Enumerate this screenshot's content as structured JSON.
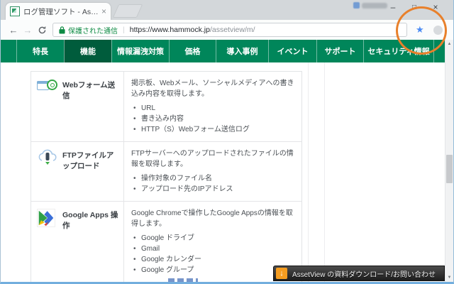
{
  "tab": {
    "title": "ログ管理ソフト - AssetView"
  },
  "window_controls": {
    "minimize": "–",
    "maximize": "□",
    "close": "×"
  },
  "icons": {
    "tab_close": "×",
    "back_arrow": "←",
    "forward_arrow": "→",
    "bookmark_star": "★",
    "menu_dots": "⋮",
    "scroll_up": "▲",
    "scroll_down": "▼",
    "banner_arrow": "↓"
  },
  "toolbar": {
    "secure_label": "保護された通信",
    "separator": "|",
    "url_host": "https://www.hammock.jp",
    "url_path": "/assetview/m/"
  },
  "nav": {
    "items": [
      {
        "label": "特長"
      },
      {
        "label": "機能",
        "active": true
      },
      {
        "label": "情報漏洩対策"
      },
      {
        "label": "価格"
      },
      {
        "label": "導入事例"
      },
      {
        "label": "イベント"
      },
      {
        "label": "サポート"
      },
      {
        "label": "セキュリティ情報"
      }
    ]
  },
  "features": {
    "rows": [
      {
        "icon": "web-form-icon",
        "title": "Webフォーム送信",
        "desc": "掲示板、Webメール、ソーシャルメディアへの書き込み内容を取得します。",
        "bullets": [
          "URL",
          "書き込み内容",
          "HTTP（S）Webフォーム送信ログ"
        ]
      },
      {
        "icon": "ftp-upload-icon",
        "title": "FTPファイルアップロード",
        "desc": "FTPサーバーへのアップロードされたファイルの情報を取得します。",
        "bullets": [
          "操作対象のファイル名",
          "アップロード先のIPアドレス"
        ]
      },
      {
        "icon": "google-apps-icon",
        "title": "Google Apps 操作",
        "desc": "Google Chromeで操作したGoogle Appsの情報を取得します。",
        "bullets": [
          "Google ドライブ",
          "Gmail",
          "Google カレンダー",
          "Google グループ"
        ]
      }
    ]
  },
  "banner": {
    "label": "AssetView の資料ダウンロード/お問い合わせ"
  },
  "colors": {
    "nav_green": "#00865a",
    "nav_active_green": "#005c3c",
    "secure_green": "#0d8a43",
    "annotation_orange": "#e8802b",
    "banner_icon_orange": "#f49c20",
    "bookmark_blue": "#4b8bf4"
  }
}
